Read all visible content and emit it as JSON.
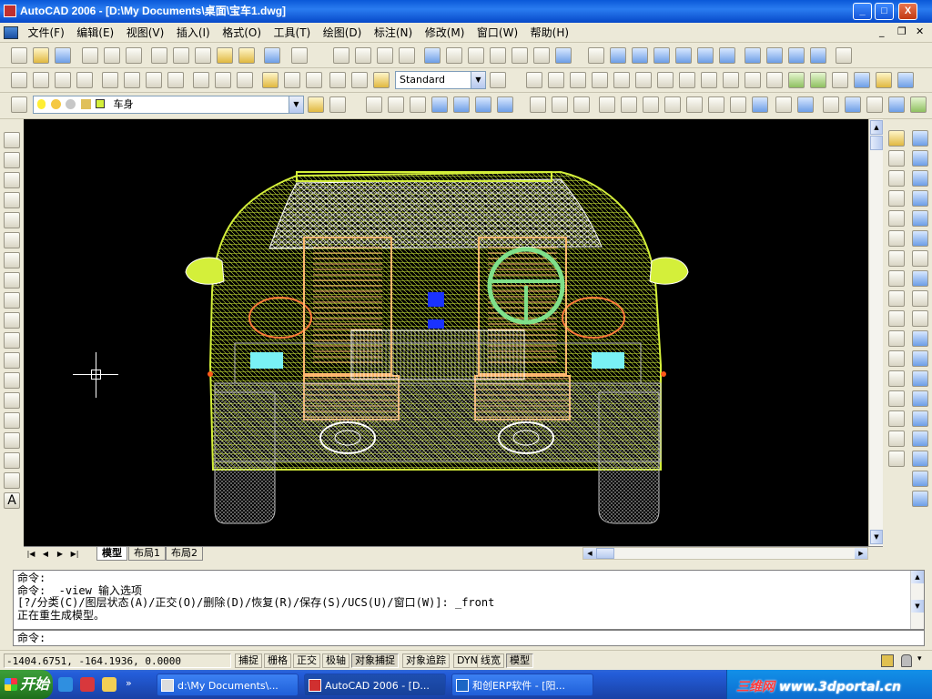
{
  "window": {
    "title": "AutoCAD 2006 - [D:\\My Documents\\桌面\\宝车1.dwg]",
    "minimize": "_",
    "maximize": "□",
    "close": "X"
  },
  "menu": {
    "items": [
      "文件(F)",
      "编辑(E)",
      "视图(V)",
      "插入(I)",
      "格式(O)",
      "工具(T)",
      "绘图(D)",
      "标注(N)",
      "修改(M)",
      "窗口(W)",
      "帮助(H)"
    ],
    "doc_min": "_",
    "doc_restore": "❐",
    "doc_close": "✕"
  },
  "toolbar": {
    "text_style": "Standard",
    "layer_name": "车身"
  },
  "layout_tabs": {
    "tabs": [
      "模型",
      "布局1",
      "布局2"
    ],
    "active": "模型"
  },
  "command": {
    "history": [
      "命令:",
      "命令: _-view 输入选项",
      "[?/分类(C)/图层状态(A)/正交(O)/删除(D)/恢复(R)/保存(S)/UCS(U)/窗口(W)]: _front",
      "正在重生成模型。"
    ],
    "prompt": "命令:"
  },
  "status": {
    "coordinates": "-1404.6751, -164.1936, 0.0000",
    "buttons": [
      "捕捉",
      "栅格",
      "正交",
      "极轴",
      "对象捕捉",
      "对象追踪",
      "DYN",
      "线宽",
      "模型"
    ],
    "on": [
      "对象捕捉",
      "模型"
    ]
  },
  "taskbar": {
    "start": "开始",
    "tasks": [
      "d:\\My Documents\\...",
      "AutoCAD 2006 - [D...",
      "和创ERP软件 - [阳..."
    ],
    "watermark_a": "三维网",
    "watermark_b": "www.3dportal.cn"
  },
  "colors": {
    "canvas_bg": "#000000",
    "wire_yellow": "#d4ef3a",
    "wire_orange": "#ffb870",
    "wire_green": "#7fe08a",
    "wire_white": "#ffffff",
    "wire_gray": "#bdbdbd",
    "wire_cyan": "#79f1f5",
    "wire_blue": "#1a32ff",
    "title_blue": "#0a58d8"
  }
}
